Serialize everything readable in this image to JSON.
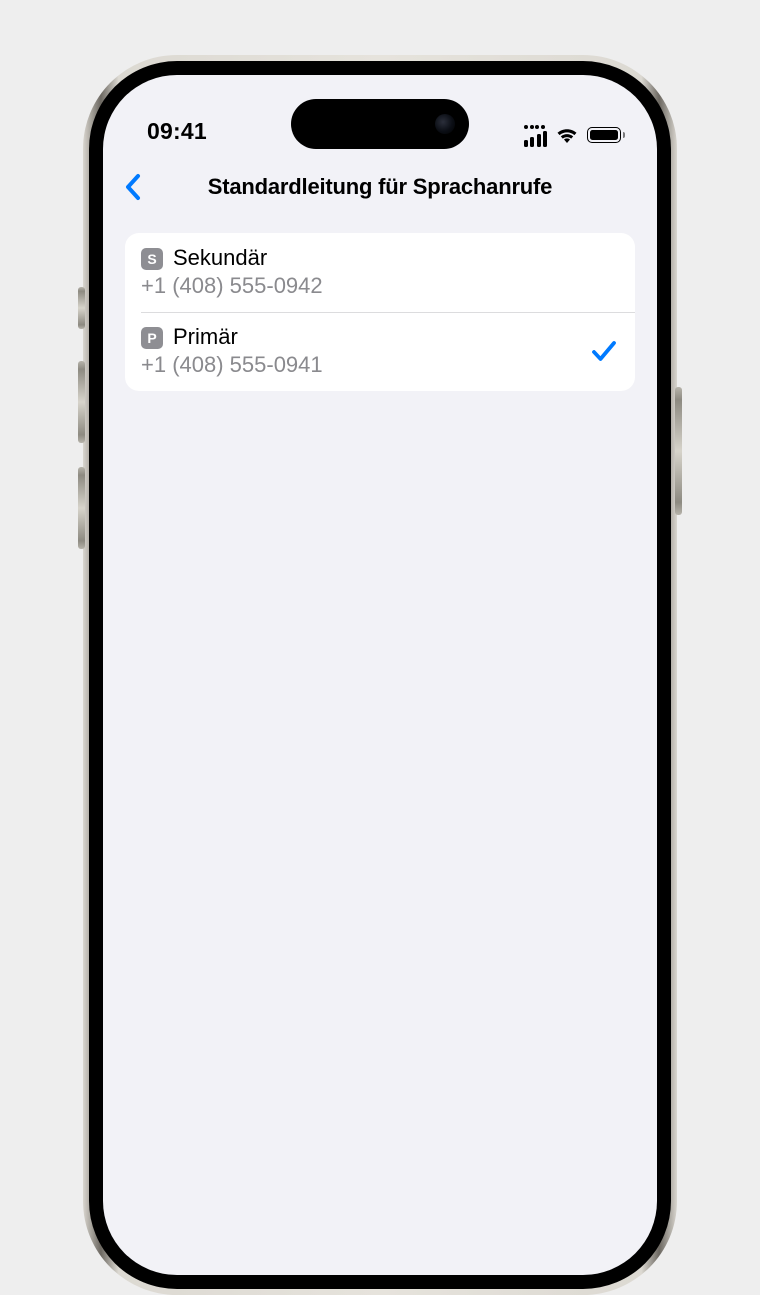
{
  "statusbar": {
    "time": "09:41"
  },
  "nav": {
    "title": "Standardleitung für Sprachanrufe"
  },
  "list": {
    "items": [
      {
        "badge": "S",
        "label": "Sekundär",
        "number": "+1 (408) 555-0942",
        "selected": false
      },
      {
        "badge": "P",
        "label": "Primär",
        "number": "+1 (408) 555-0941",
        "selected": true
      }
    ]
  },
  "colors": {
    "accent": "#007aff"
  }
}
